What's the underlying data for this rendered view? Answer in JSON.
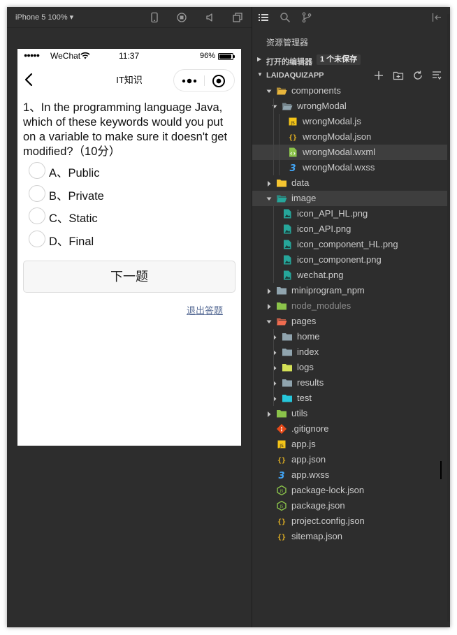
{
  "simulator": {
    "device_label": "iPhone 5 100% ▾",
    "toolbar_icons": [
      "phone-icon",
      "record-icon",
      "volume-icon",
      "detach-window-icon"
    ]
  },
  "phone": {
    "status": {
      "carrier": "WeChat",
      "time": "11:37",
      "battery": "96%",
      "signal": "●●●●●"
    },
    "nav": {
      "title": "IT知识"
    },
    "question": "1、In the programming language Java, which of these keywords would you put on a variable to make sure it doesn't get modified?（10分）",
    "options": [
      {
        "label": "A、Public"
      },
      {
        "label": "B、Private"
      },
      {
        "label": "C、Static"
      },
      {
        "label": "D、Final"
      }
    ],
    "next_button": "下一题",
    "quit_link": "退出答题"
  },
  "explorer": {
    "title": "资源管理器",
    "open_editors": {
      "label": "打开的编辑器",
      "badge": "1 个未保存"
    },
    "project": {
      "label": "LAIDAQUIZAPP"
    },
    "tree": [
      {
        "label": "components",
        "depth": 1,
        "type": "folder",
        "icon": "components-folder-icon",
        "expanded": true,
        "color": "#e8b53c"
      },
      {
        "label": "wrongModal",
        "depth": 2,
        "type": "folder",
        "icon": "folder-open-icon",
        "expanded": true,
        "color": "#90a4ae"
      },
      {
        "label": "wrongModal.js",
        "depth": 3,
        "type": "file",
        "icon": "js-file-icon",
        "color": "#f5c518"
      },
      {
        "label": "wrongModal.json",
        "depth": 3,
        "type": "file",
        "icon": "json-file-icon",
        "color": "#e6b422"
      },
      {
        "label": "wrongModal.wxml",
        "depth": 3,
        "type": "file",
        "icon": "wxml-file-icon",
        "color": "#8bc34a",
        "selected": true
      },
      {
        "label": "wrongModal.wxss",
        "depth": 3,
        "type": "file",
        "icon": "wxss-file-icon",
        "color": "#42a5f5"
      },
      {
        "label": "data",
        "depth": 1,
        "type": "folder",
        "icon": "data-folder-icon",
        "expanded": false,
        "color": "#f4c430"
      },
      {
        "label": "image",
        "depth": 1,
        "type": "folder",
        "icon": "image-folder-icon",
        "expanded": true,
        "color": "#26a69a",
        "highlight": true
      },
      {
        "label": "icon_API_HL.png",
        "depth": 2,
        "type": "file",
        "icon": "image-file-icon",
        "color": "#26a69a"
      },
      {
        "label": "icon_API.png",
        "depth": 2,
        "type": "file",
        "icon": "image-file-icon",
        "color": "#26a69a"
      },
      {
        "label": "icon_component_HL.png",
        "depth": 2,
        "type": "file",
        "icon": "image-file-icon",
        "color": "#26a69a"
      },
      {
        "label": "icon_component.png",
        "depth": 2,
        "type": "file",
        "icon": "image-file-icon",
        "color": "#26a69a"
      },
      {
        "label": "wechat.png",
        "depth": 2,
        "type": "file",
        "icon": "image-file-icon",
        "color": "#26a69a"
      },
      {
        "label": "miniprogram_npm",
        "depth": 1,
        "type": "folder",
        "icon": "folder-icon",
        "expanded": false,
        "color": "#90a4ae"
      },
      {
        "label": "node_modules",
        "depth": 1,
        "type": "folder",
        "icon": "node-folder-icon",
        "expanded": false,
        "color": "#8bc34a",
        "dim": true
      },
      {
        "label": "pages",
        "depth": 1,
        "type": "folder",
        "icon": "pages-folder-icon",
        "expanded": true,
        "color": "#ef6c50"
      },
      {
        "label": "home",
        "depth": 2,
        "type": "folder",
        "icon": "folder-icon",
        "expanded": false,
        "color": "#90a4ae"
      },
      {
        "label": "index",
        "depth": 2,
        "type": "folder",
        "icon": "folder-icon",
        "expanded": false,
        "color": "#90a4ae"
      },
      {
        "label": "logs",
        "depth": 2,
        "type": "folder",
        "icon": "logs-folder-icon",
        "expanded": false,
        "color": "#d4e157"
      },
      {
        "label": "results",
        "depth": 2,
        "type": "folder",
        "icon": "folder-icon",
        "expanded": false,
        "color": "#90a4ae"
      },
      {
        "label": "test",
        "depth": 2,
        "type": "folder",
        "icon": "test-folder-icon",
        "expanded": false,
        "color": "#26c6da"
      },
      {
        "label": "utils",
        "depth": 1,
        "type": "folder",
        "icon": "utils-folder-icon",
        "expanded": false,
        "color": "#8bc34a"
      },
      {
        "label": ".gitignore",
        "depth": 1,
        "type": "file",
        "icon": "git-file-icon",
        "color": "#e64a19"
      },
      {
        "label": "app.js",
        "depth": 1,
        "type": "file",
        "icon": "js-file-icon",
        "color": "#f5c518"
      },
      {
        "label": "app.json",
        "depth": 1,
        "type": "file",
        "icon": "json-file-icon",
        "color": "#e6b422"
      },
      {
        "label": "app.wxss",
        "depth": 1,
        "type": "file",
        "icon": "wxss-file-icon",
        "color": "#42a5f5"
      },
      {
        "label": "package-lock.json",
        "depth": 1,
        "type": "file",
        "icon": "node-file-icon",
        "color": "#8bc34a"
      },
      {
        "label": "package.json",
        "depth": 1,
        "type": "file",
        "icon": "node-file-icon",
        "color": "#8bc34a"
      },
      {
        "label": "project.config.json",
        "depth": 1,
        "type": "file",
        "icon": "json-file-icon",
        "color": "#e6b422"
      },
      {
        "label": "sitemap.json",
        "depth": 1,
        "type": "file",
        "icon": "json-file-icon",
        "color": "#e6b422"
      }
    ]
  }
}
